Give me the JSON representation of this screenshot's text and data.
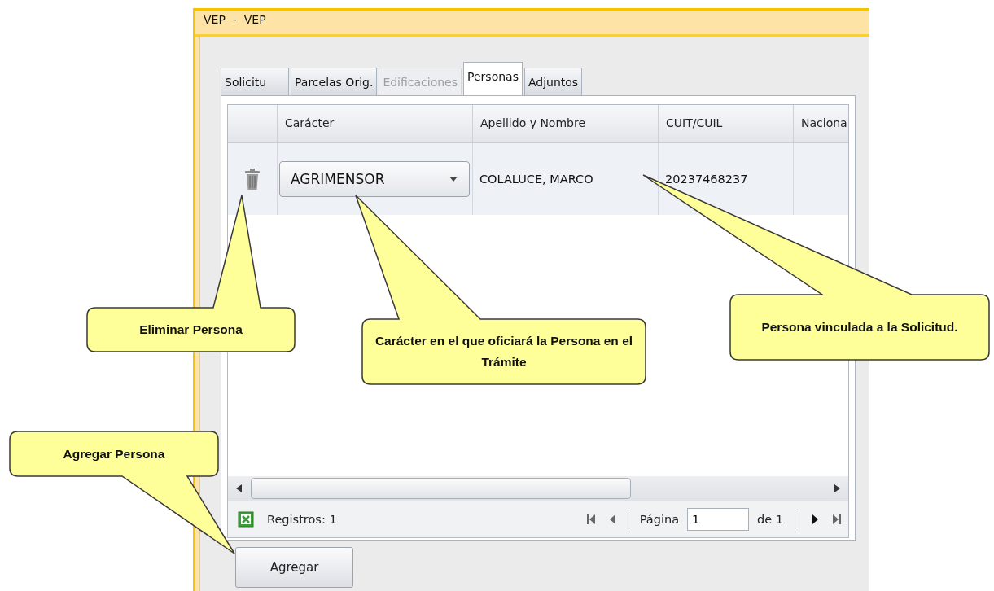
{
  "window": {
    "title": "VEP  -  VEP"
  },
  "tabs": [
    {
      "label": "Solicitu",
      "selected": false,
      "disabled": false
    },
    {
      "label": "Parcelas Orig.",
      "selected": false,
      "disabled": false
    },
    {
      "label": "Edificaciones",
      "selected": false,
      "disabled": true
    },
    {
      "label": "Personas",
      "selected": true,
      "disabled": false
    },
    {
      "label": "Adjuntos",
      "selected": false,
      "disabled": false
    }
  ],
  "grid": {
    "columns": [
      "Carácter",
      "Apellido y Nombre",
      "CUIT/CUIL",
      "Naciona"
    ],
    "rows": [
      {
        "caracter": "AGRIMENSOR",
        "nombre": "COLALUCE, MARCO",
        "cuit": "20237468237"
      }
    ]
  },
  "footer": {
    "records": "Registros: 1",
    "page_label": "Página",
    "page_value": "1",
    "page_total": "de 1"
  },
  "add_button": "Agregar",
  "callouts": [
    "Eliminar Persona",
    "Carácter en el que oficiará la Persona en el Trámite",
    "Persona vinculada a la Solicitud.",
    "Agregar Persona"
  ]
}
